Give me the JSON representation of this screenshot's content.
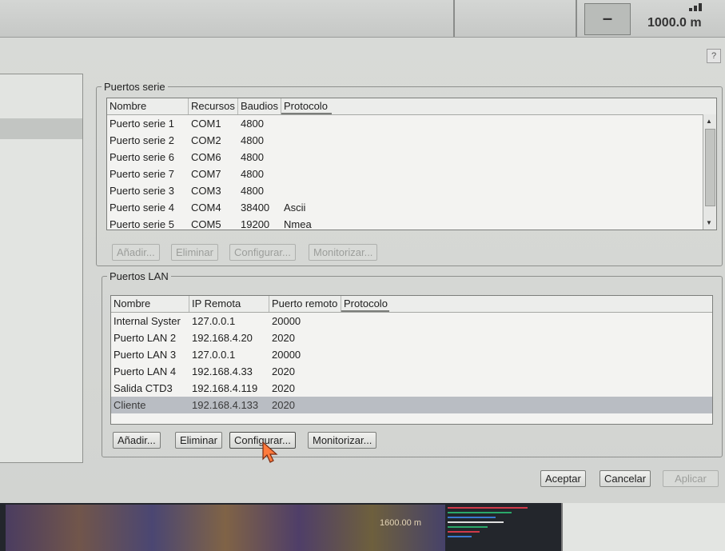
{
  "top": {
    "minus_label": "–",
    "readout": "1000.0 m"
  },
  "dialog": {
    "help_label": "?",
    "serial": {
      "legend": "Puertos serie",
      "columns": [
        "Nombre",
        "Recursos",
        "Baudios",
        "Protocolo"
      ],
      "rows": [
        [
          "Puerto serie 1",
          "COM1",
          "4800",
          ""
        ],
        [
          "Puerto serie 2",
          "COM2",
          "4800",
          ""
        ],
        [
          "Puerto serie 6",
          "COM6",
          "4800",
          ""
        ],
        [
          "Puerto serie 7",
          "COM7",
          "4800",
          ""
        ],
        [
          "Puerto serie 3",
          "COM3",
          "4800",
          ""
        ],
        [
          "Puerto serie 4",
          "COM4",
          "38400",
          "Ascii"
        ],
        [
          "Puerto serie 5",
          "COM5",
          "19200",
          "Nmea"
        ]
      ],
      "buttons": [
        "Añadir...",
        "Eliminar",
        "Configurar...",
        "Monitorizar..."
      ]
    },
    "lan": {
      "legend": "Puertos LAN",
      "columns": [
        "Nombre",
        "IP Remota",
        "Puerto remoto",
        "Protocolo"
      ],
      "rows": [
        [
          "Internal Syster",
          "127.0.0.1",
          "20000",
          ""
        ],
        [
          "Puerto LAN 2",
          "192.168.4.20",
          "2020",
          ""
        ],
        [
          "Puerto LAN 3",
          "127.0.0.1",
          "20000",
          ""
        ],
        [
          "Puerto LAN 4",
          "192.168.4.33",
          "2020",
          ""
        ],
        [
          "Salida CTD3",
          "192.168.4.119",
          "2020",
          ""
        ],
        [
          "Cliente",
          "192.168.4.133",
          "2020",
          ""
        ]
      ],
      "selected_row": 5,
      "buttons": [
        "Añadir...",
        "Eliminar",
        "Configurar...",
        "Monitorizar..."
      ]
    },
    "footer": {
      "accept": "Aceptar",
      "cancel": "Cancelar",
      "apply": "Aplicar"
    }
  },
  "background": {
    "spectrum_label": "1600.00 m"
  }
}
